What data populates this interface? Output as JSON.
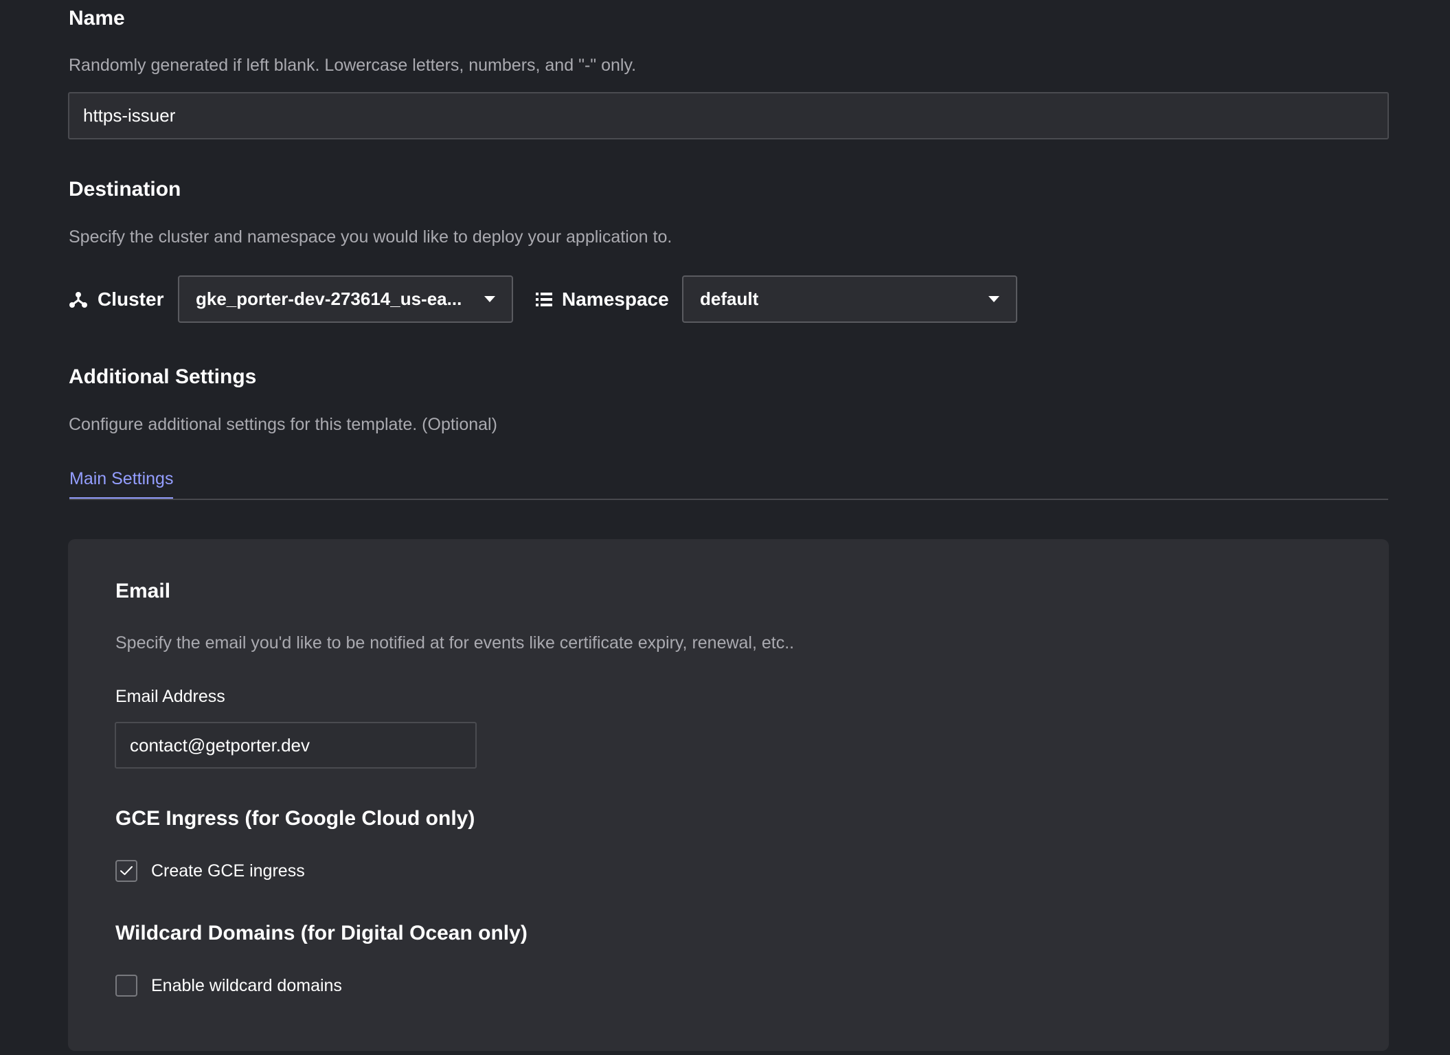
{
  "name_section": {
    "title": "Name",
    "description": "Randomly generated if left blank. Lowercase letters, numbers, and \"-\" only.",
    "input_value": "https-issuer"
  },
  "destination": {
    "title": "Destination",
    "description": "Specify the cluster and namespace you would like to deploy your application to.",
    "cluster_label": "Cluster",
    "cluster_value": "gke_porter-dev-273614_us-ea...",
    "namespace_label": "Namespace",
    "namespace_value": "default"
  },
  "additional": {
    "title": "Additional Settings",
    "description": "Configure additional settings for this template. (Optional)",
    "tabs": [
      {
        "label": "Main Settings",
        "active": true
      }
    ]
  },
  "email": {
    "title": "Email",
    "description": "Specify the email you'd like to be notified at for events like certificate expiry, renewal, etc..",
    "field_label": "Email Address",
    "field_value": "contact@getporter.dev"
  },
  "gce": {
    "title": "GCE Ingress (for Google Cloud only)",
    "checkbox_label": "Create GCE ingress",
    "checked": true
  },
  "wildcard": {
    "title": "Wildcard Domains (for Digital Ocean only)",
    "checkbox_label": "Enable wildcard domains",
    "checked": false
  },
  "colors": {
    "background": "#202227",
    "card": "#2e2f34",
    "accent": "#949eff"
  },
  "icons": {
    "cluster": "cluster-icon",
    "namespace": "list-icon",
    "dropdown": "caret-down-icon",
    "check": "checkmark-icon"
  }
}
